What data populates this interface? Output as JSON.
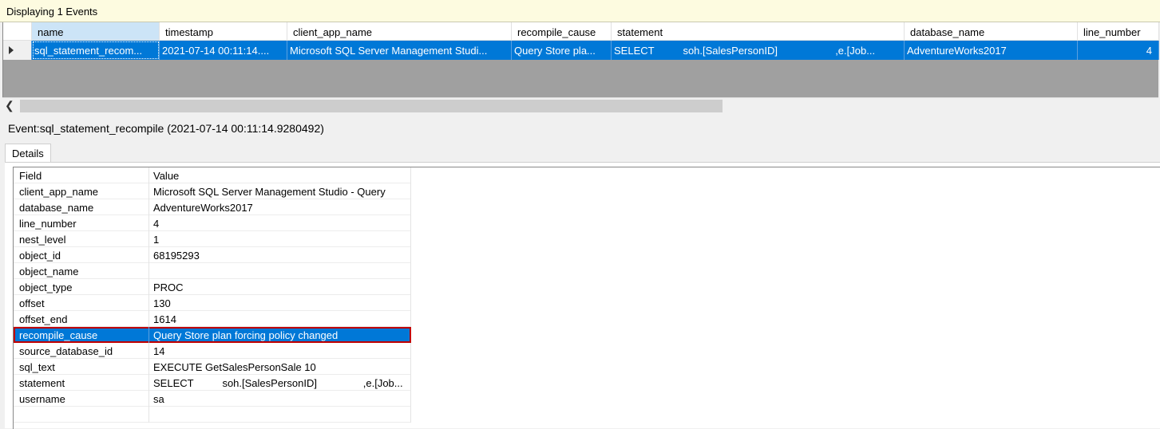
{
  "status": "Displaying 1 Events",
  "grid": {
    "headers": [
      "name",
      "timestamp",
      "client_app_name",
      "recompile_cause",
      "statement",
      "database_name",
      "line_number"
    ],
    "row": [
      "sql_statement_recom...",
      "2021-07-14 00:11:14....",
      "Microsoft SQL Server Management Studi...",
      "Query Store pla...",
      "SELECT          soh.[SalesPersonID]                    ,e.[Job...",
      "AdventureWorks2017",
      "4"
    ]
  },
  "event_title": "Event:sql_statement_recompile (2021-07-14 00:11:14.9280492)",
  "tab_label": "Details",
  "details": {
    "header_field": "Field",
    "header_value": "Value",
    "rows": [
      {
        "field": "client_app_name",
        "value": "Microsoft SQL Server Management Studio - Query"
      },
      {
        "field": "database_name",
        "value": "AdventureWorks2017"
      },
      {
        "field": "line_number",
        "value": "4"
      },
      {
        "field": "nest_level",
        "value": "1"
      },
      {
        "field": "object_id",
        "value": "68195293"
      },
      {
        "field": "object_name",
        "value": ""
      },
      {
        "field": "object_type",
        "value": "PROC"
      },
      {
        "field": "offset",
        "value": "130"
      },
      {
        "field": "offset_end",
        "value": "1614"
      },
      {
        "field": "recompile_cause",
        "value": "Query Store plan forcing policy changed"
      },
      {
        "field": "source_database_id",
        "value": "14"
      },
      {
        "field": "sql_text",
        "value": "EXECUTE GetSalesPersonSale 10"
      },
      {
        "field": "statement",
        "value": "SELECT          soh.[SalesPersonID]                ,e.[Job..."
      },
      {
        "field": "username",
        "value": "sa"
      }
    ]
  },
  "colors": {
    "selection": "#0078d7",
    "highlight_border": "#c00000",
    "status_bg": "#fdfbe0"
  }
}
